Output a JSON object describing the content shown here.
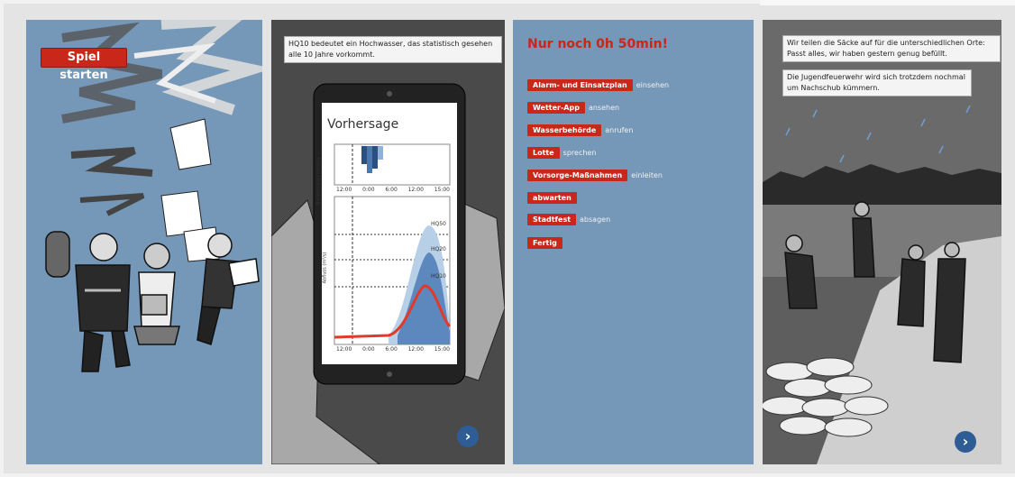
{
  "panel1": {
    "start_button": "Spiel starten"
  },
  "panel2": {
    "caption": "HQ10 bedeutet ein Hochwasser, das statistisch gesehen alle 10 Jahre vorkommt.",
    "forecast": {
      "title": "Vorhersage",
      "precip_ylabel": "Niederschlag (mm/h)",
      "flow_ylabel": "Abfluss (m³/s)",
      "x_ticks_top": [
        "12:00",
        "0:00",
        "6:00",
        "12:00",
        "15:00"
      ],
      "x_ticks_bottom": [
        "12:00",
        "0:00",
        "6:00",
        "12:00",
        "15:00"
      ],
      "levels": [
        "HQ50",
        "HQ20",
        "HQ10"
      ]
    },
    "next_icon": "chevron-right-icon"
  },
  "panel3": {
    "countdown": "Nur noch 0h 50min!",
    "actions": [
      {
        "label": "Alarm- und Einsatzplan",
        "verb": "einsehen"
      },
      {
        "label": "Wetter-App",
        "verb": "ansehen"
      },
      {
        "label": "Wasserbehörde",
        "verb": "anrufen"
      },
      {
        "label": "Lotte",
        "verb": "sprechen"
      },
      {
        "label": "Vorsorge-Maßnahmen",
        "verb": "einleiten"
      },
      {
        "label": "abwarten",
        "verb": ""
      },
      {
        "label": "Stadtfest",
        "verb": "absagen"
      },
      {
        "label": "Fertig",
        "verb": ""
      }
    ]
  },
  "panel4": {
    "caption1": "Wir teilen die Säcke auf für die unterschiedlichen Orte: Passt alles, wir haben gestern genug befüllt.",
    "caption2": "Die Jugendfeuerwehr wird sich trotzdem nochmal um Nachschub kümmern.",
    "next_icon": "chevron-right-icon"
  },
  "colors": {
    "accent_red": "#c8271a",
    "panel_blue": "#7597b8",
    "next_blue": "#2e5d96"
  }
}
